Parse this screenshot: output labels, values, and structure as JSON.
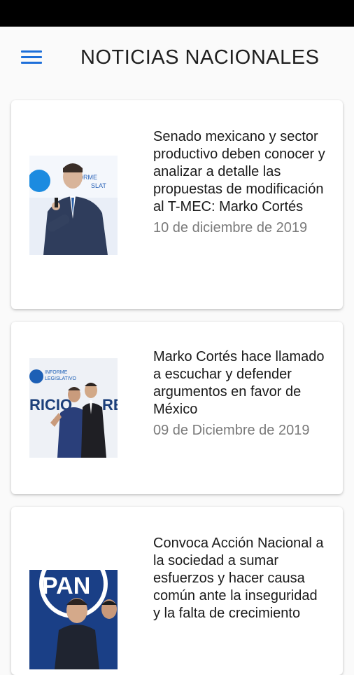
{
  "app_bar": {
    "title": "NOTICIAS NACIONALES",
    "menu_icon": "hamburger-menu-icon",
    "accent_color": "#1e6fd9"
  },
  "news": [
    {
      "headline": "Senado mexicano y sector productivo deben conocer y analizar a detalle las propuestas de modificación al T-MEC: Marko Cortés",
      "date": "10 de diciembre de 2019"
    },
    {
      "headline": "Marko Cortés hace llamado a escuchar y defender argumentos en favor de México",
      "date": "09 de Diciembre de 2019"
    },
    {
      "headline": "Convoca Acción Nacional a la sociedad a sumar esfuerzos y hacer causa común ante la inseguridad y la falta de crecimiento",
      "date": ""
    }
  ]
}
